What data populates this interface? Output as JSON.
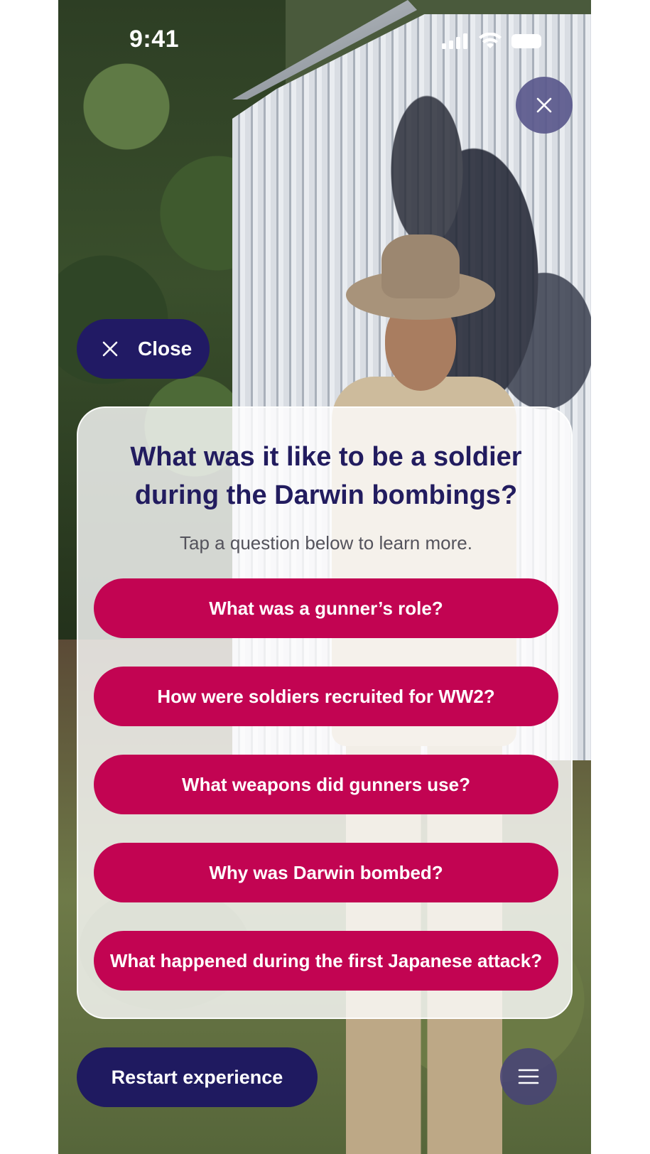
{
  "status_bar": {
    "time": "9:41",
    "icons": [
      "signal-icon",
      "wifi-icon",
      "battery-icon"
    ]
  },
  "close_pill": {
    "label": "Close",
    "icon": "close-icon"
  },
  "card": {
    "title": "What was it like to be a soldier during the Darwin bombings?",
    "subtitle": "Tap a question below to learn more.",
    "questions": [
      "What was a gunner’s role?",
      "How were soldiers recruited for WW2?",
      "What weapons did gunners use?",
      "Why was Darwin bombed?",
      "What happened during the first Japanese attack?"
    ]
  },
  "restart": {
    "label": "Restart experience"
  },
  "menu": {
    "icon": "menu-icon"
  },
  "top_close": {
    "icon": "close-icon"
  },
  "colors": {
    "navy": "#211a64",
    "crimson": "#c20452",
    "title_text": "#221c5f",
    "muted_text": "#54535c"
  }
}
